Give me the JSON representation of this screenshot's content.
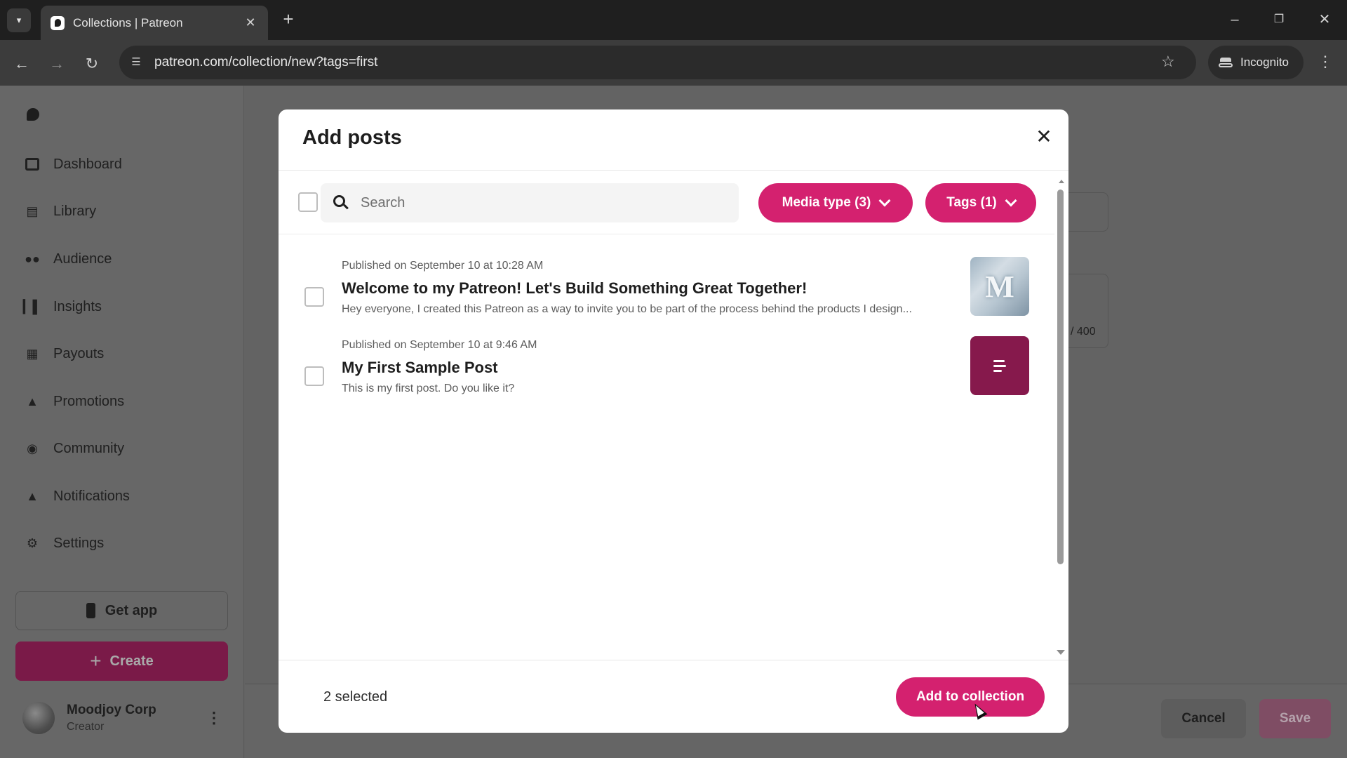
{
  "browser": {
    "tab_title": "Collections | Patreon",
    "url": "patreon.com/collection/new?tags=first",
    "incognito_label": "Incognito"
  },
  "sidebar": {
    "items": [
      {
        "label": "Dashboard",
        "icon": "dashboard-icon"
      },
      {
        "label": "Library",
        "icon": "library-icon"
      },
      {
        "label": "Audience",
        "icon": "audience-icon"
      },
      {
        "label": "Insights",
        "icon": "insights-icon"
      },
      {
        "label": "Payouts",
        "icon": "payouts-icon"
      },
      {
        "label": "Promotions",
        "icon": "megaphone-icon"
      },
      {
        "label": "Community",
        "icon": "chat-icon"
      },
      {
        "label": "Notifications",
        "icon": "bell-icon"
      },
      {
        "label": "Settings",
        "icon": "gear-icon"
      }
    ],
    "get_app_label": "Get app",
    "create_label": "Create",
    "user": {
      "name": "Moodjoy Corp",
      "role": "Creator"
    }
  },
  "background": {
    "char_count": "/ 400",
    "cancel_label": "Cancel",
    "save_label": "Save"
  },
  "modal": {
    "title": "Add posts",
    "search_placeholder": "Search",
    "filters": {
      "media_type_label": "Media type (3)",
      "tags_label": "Tags (1)"
    },
    "posts": [
      {
        "published": "Published on September 10 at 10:28 AM",
        "title": "Welcome to my Patreon! Let's Build Something Great Together!",
        "excerpt": "Hey everyone, I created this Patreon as a way to invite you to be part of the process behind the products I design...",
        "thumbnail": "image"
      },
      {
        "published": "Published on September 10 at 9:46 AM",
        "title": "My First Sample Post",
        "excerpt": "This is my first post. Do you like it?",
        "thumbnail": "text-post-icon"
      }
    ],
    "selected_count": "2 selected",
    "add_button_label": "Add to collection"
  },
  "colors": {
    "accent": "#d4216f",
    "text_post_thumb": "#86194c"
  }
}
